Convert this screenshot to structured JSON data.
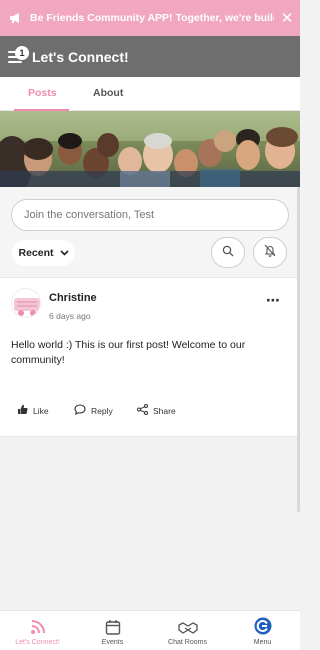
{
  "announcement": {
    "icon": "megaphone-icon",
    "text": "Be Friends Community APP! Together, we're building",
    "close_icon": "close-icon"
  },
  "header": {
    "notification_count": "1",
    "title": "Let's Connect!"
  },
  "tabs": [
    {
      "label": "Posts",
      "active": true
    },
    {
      "label": "About",
      "active": false
    }
  ],
  "search": {
    "placeholder": "Join the conversation, Test"
  },
  "filter": {
    "sort_label": "Recent"
  },
  "post": {
    "author": "Christine",
    "time": "6 days ago",
    "body": "Hello world :) This is our first post! Welcome to our community!",
    "actions": {
      "like": "Like",
      "reply": "Reply",
      "share": "Share"
    }
  },
  "bottom_nav": [
    {
      "label": "Let's Connect!",
      "icon": "wifi-feed-icon",
      "active": true
    },
    {
      "label": "Events",
      "icon": "calendar-icon",
      "active": false
    },
    {
      "label": "Chat Rooms",
      "icon": "handshake-icon",
      "active": false
    },
    {
      "label": "Menu",
      "icon": "app-logo-icon",
      "active": false
    }
  ],
  "colors": {
    "accent": "#f28cae",
    "announcement_bg": "#f0a7bf",
    "header_bg": "#6e6e6e"
  }
}
